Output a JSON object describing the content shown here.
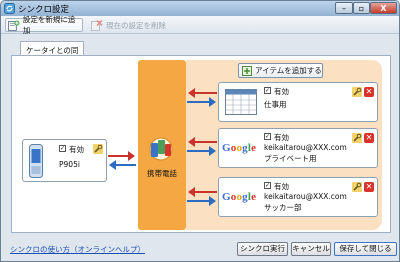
{
  "window": {
    "title": "シンクロ設定",
    "min": "–",
    "max": "▫",
    "close": "X"
  },
  "toolbar": {
    "add_label": "設定を新規に追加",
    "delete_label": "現在の設定を削除"
  },
  "tab": {
    "label": "ケータイとの同期"
  },
  "add_items_label": "アイテムを追加する",
  "device": {
    "enabled_label": "有効",
    "model": "P905i"
  },
  "hub": {
    "label": "携帯電話"
  },
  "targets": [
    {
      "enabled_label": "有効",
      "line1": "仕事用",
      "line2": ""
    },
    {
      "enabled_label": "有効",
      "line1": "keikaitarou@XXX.com",
      "line2": "プライベート用"
    },
    {
      "enabled_label": "有効",
      "line1": "keikaitarou@XXX.com",
      "line2": "サッカー部"
    }
  ],
  "google_logo": "Google",
  "footer": {
    "help_link": "シンクロの使い方（オンラインヘルプ）",
    "run": "シンクロ実行",
    "cancel": "キャンセル",
    "save_close": "保存して閉じる"
  },
  "colors": {
    "orange": "#f4a742",
    "peach": "#fbe0c2",
    "arrow_red": "#c9332c",
    "arrow_blue": "#2b6cc0",
    "link": "#1a4fb5"
  },
  "icons": {
    "app": "sync-app-icon",
    "add": "add-config-icon",
    "delete": "delete-config-icon",
    "phone": "phone-icon",
    "calendar": "calendar-icon",
    "hub": "phone-hub-icon",
    "wrench": "wrench-icon",
    "remove": "remove-x-icon"
  }
}
